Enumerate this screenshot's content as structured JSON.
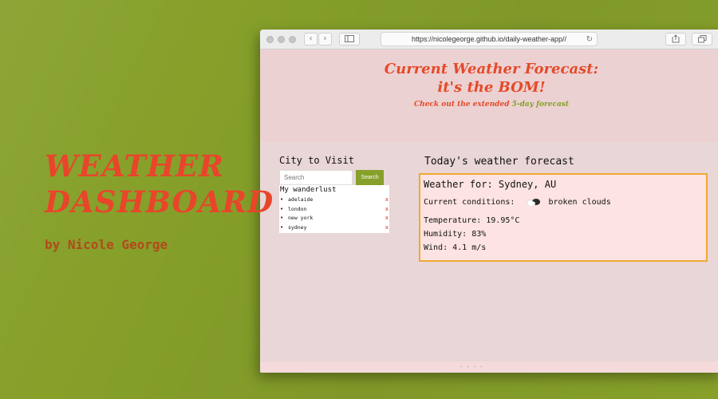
{
  "promo": {
    "title_line1": "WEATHER",
    "title_line2": "DASHBOARD",
    "byline": "by Nicole George"
  },
  "browser": {
    "url": "https://nicolegeorge.github.io/daily-weather-app//"
  },
  "hero": {
    "title_line1": "Current Weather Forecast:",
    "title_line2": "it's the BOM!",
    "subtitle_prefix": "Check out the extended ",
    "subtitle_link": "5-day forecast"
  },
  "sidebar": {
    "heading": "City to Visit",
    "search_placeholder": "Search",
    "search_button": "Search",
    "list_title": "My wanderlust",
    "cities": [
      "adelaide",
      "london",
      "new york",
      "sydney"
    ],
    "bullet": "•",
    "remove_label": "x"
  },
  "forecast": {
    "heading": "Today's weather forecast",
    "location": "Weather for: Sydney, AU",
    "conditions_label": "Current conditions:",
    "conditions_value": "broken clouds",
    "temperature": "Temperature: 19.95°C",
    "humidity": "Humidity: 83%",
    "wind": "Wind: 4.1 m/s"
  },
  "footer": {
    "text": "· · · ·"
  },
  "colors": {
    "background": "#86a02a",
    "accent_red": "#e44a28",
    "accent_green": "#86a02a",
    "card_border": "#f0a933",
    "remove_red": "#e02020"
  },
  "icons": {
    "back": "chevron-left-icon",
    "forward": "chevron-right-icon",
    "sidebar": "sidebar-icon",
    "reload": "reload-icon",
    "share": "share-icon",
    "tabs": "tabs-icon",
    "weather": "broken-clouds-icon"
  }
}
